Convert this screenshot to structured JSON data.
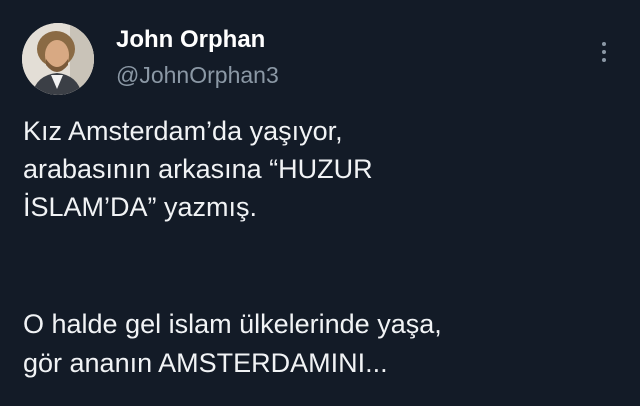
{
  "tweet": {
    "author_name": "John Orphan",
    "author_handle": "@JohnOrphan3",
    "avatar_icon": "profile-photo",
    "more_icon": "more-vertical-icon",
    "paragraph1": "Kız Amsterdam’da yaşıyor,\narabasının arkasına “HUZUR\nİSLAM’DA” yazmış.",
    "paragraph2": "O halde gel islam ülkelerinde yaşa,\ngör ananın AMSTERDAMINI..."
  },
  "colors": {
    "background": "#131b27",
    "text": "#f1f3f5",
    "secondary_text": "#8b98a5"
  }
}
